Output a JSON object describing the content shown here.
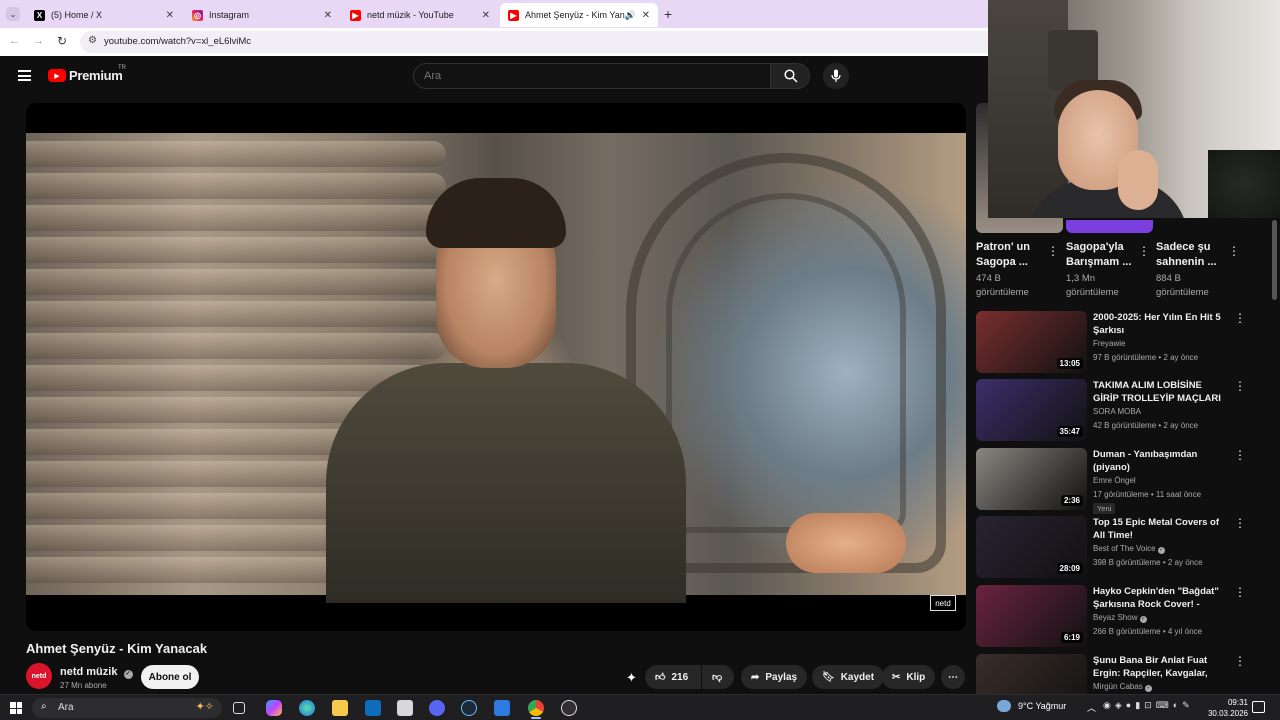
{
  "browser": {
    "tabs": [
      {
        "label": "(5) Home / X",
        "icon": "x-logo-icon"
      },
      {
        "label": "Instagram",
        "icon": "instagram-icon"
      },
      {
        "label": "netd müzik - YouTube",
        "icon": "youtube-icon"
      },
      {
        "label": "Ahmet Şenyüz - Kim Yanaca",
        "icon": "youtube-icon",
        "active": true
      }
    ],
    "url": "youtube.com/watch?v=xl_eL6lviMc"
  },
  "header": {
    "logo_text": "Premium",
    "logo_region": "TR",
    "search_placeholder": "Ara"
  },
  "video": {
    "title": "Ahmet Şenyüz - Kim Yanacak",
    "watermark": "netd",
    "channel_name": "netd müzik",
    "channel_avatar_text": "netd",
    "subscribers": "27 Mn abone",
    "subscribe_label": "Abone ol",
    "like_count": "216",
    "share_label": "Paylaş",
    "save_label": "Kaydet",
    "clip_label": "Klip"
  },
  "shorts": [
    {
      "title": "Patron' un Sagopa ...",
      "views": "474 B",
      "views_suffix": "görüntüleme"
    },
    {
      "title": "Sagopa'yla Barışmam ...",
      "views": "1,3 Mn",
      "views_suffix": "görüntüleme"
    },
    {
      "title": "Sadece şu sahnenin ...",
      "views": "884 B",
      "views_suffix": "görüntüleme"
    }
  ],
  "recommendations": [
    {
      "title": "2000-2025: Her Yılın En Hit 5 Şarkısı",
      "channel": "Freyawie",
      "meta": "97 B görüntüleme • 2 ay önce",
      "duration": "13:05",
      "thumb_color": "#7a2e2e",
      "verified": false
    },
    {
      "title": "TAKIMA ALIM LOBİSİNE GİRİP TROLLEYİP MAÇLARI TAŞIDI...",
      "channel": "SORA MOBA",
      "meta": "42 B görüntüleme • 2 ay önce",
      "duration": "35:47",
      "thumb_color": "#3c2f6b",
      "verified": false
    },
    {
      "title": "Duman - Yanıbaşımdan (piyano)",
      "channel": "Emre Öngel",
      "meta": "17 görüntüleme • 11 saat önce",
      "duration": "2:36",
      "thumb_color": "#8a8580",
      "badge": "Yeni",
      "verified": false
    },
    {
      "title": "Top 15 Epic Metal Covers of All Time!",
      "channel": "Best of The Voice",
      "meta": "398 B görüntüleme • 2 ay önce",
      "duration": "28:09",
      "thumb_color": "#2a2233",
      "verified": true
    },
    {
      "title": "Hayko Cepkin'den \"Bağdat\" Şarkısına Rock Cover! - Beyaz ...",
      "channel": "Beyaz Show",
      "meta": "266 B görüntüleme • 4 yıl önce",
      "duration": "6:19",
      "thumb_color": "#6b2340",
      "verified": true
    },
    {
      "title": "Şunu Bana Bir Anlat Fuat Ergin: Rapçiler, Kavgalar, Mafya ve ...",
      "channel": "Mirgün Cabas",
      "meta": "",
      "duration": "",
      "thumb_color": "#3a2e28",
      "verified": true
    }
  ],
  "taskbar": {
    "search_text": "Ara",
    "weather": "9°C  Yağmur",
    "time": "09:31",
    "date": "30.03.2026"
  },
  "colors": {
    "yt_red": "#ff0000",
    "background": "#0f0f0f",
    "tabbar": "#e8d8f5"
  }
}
